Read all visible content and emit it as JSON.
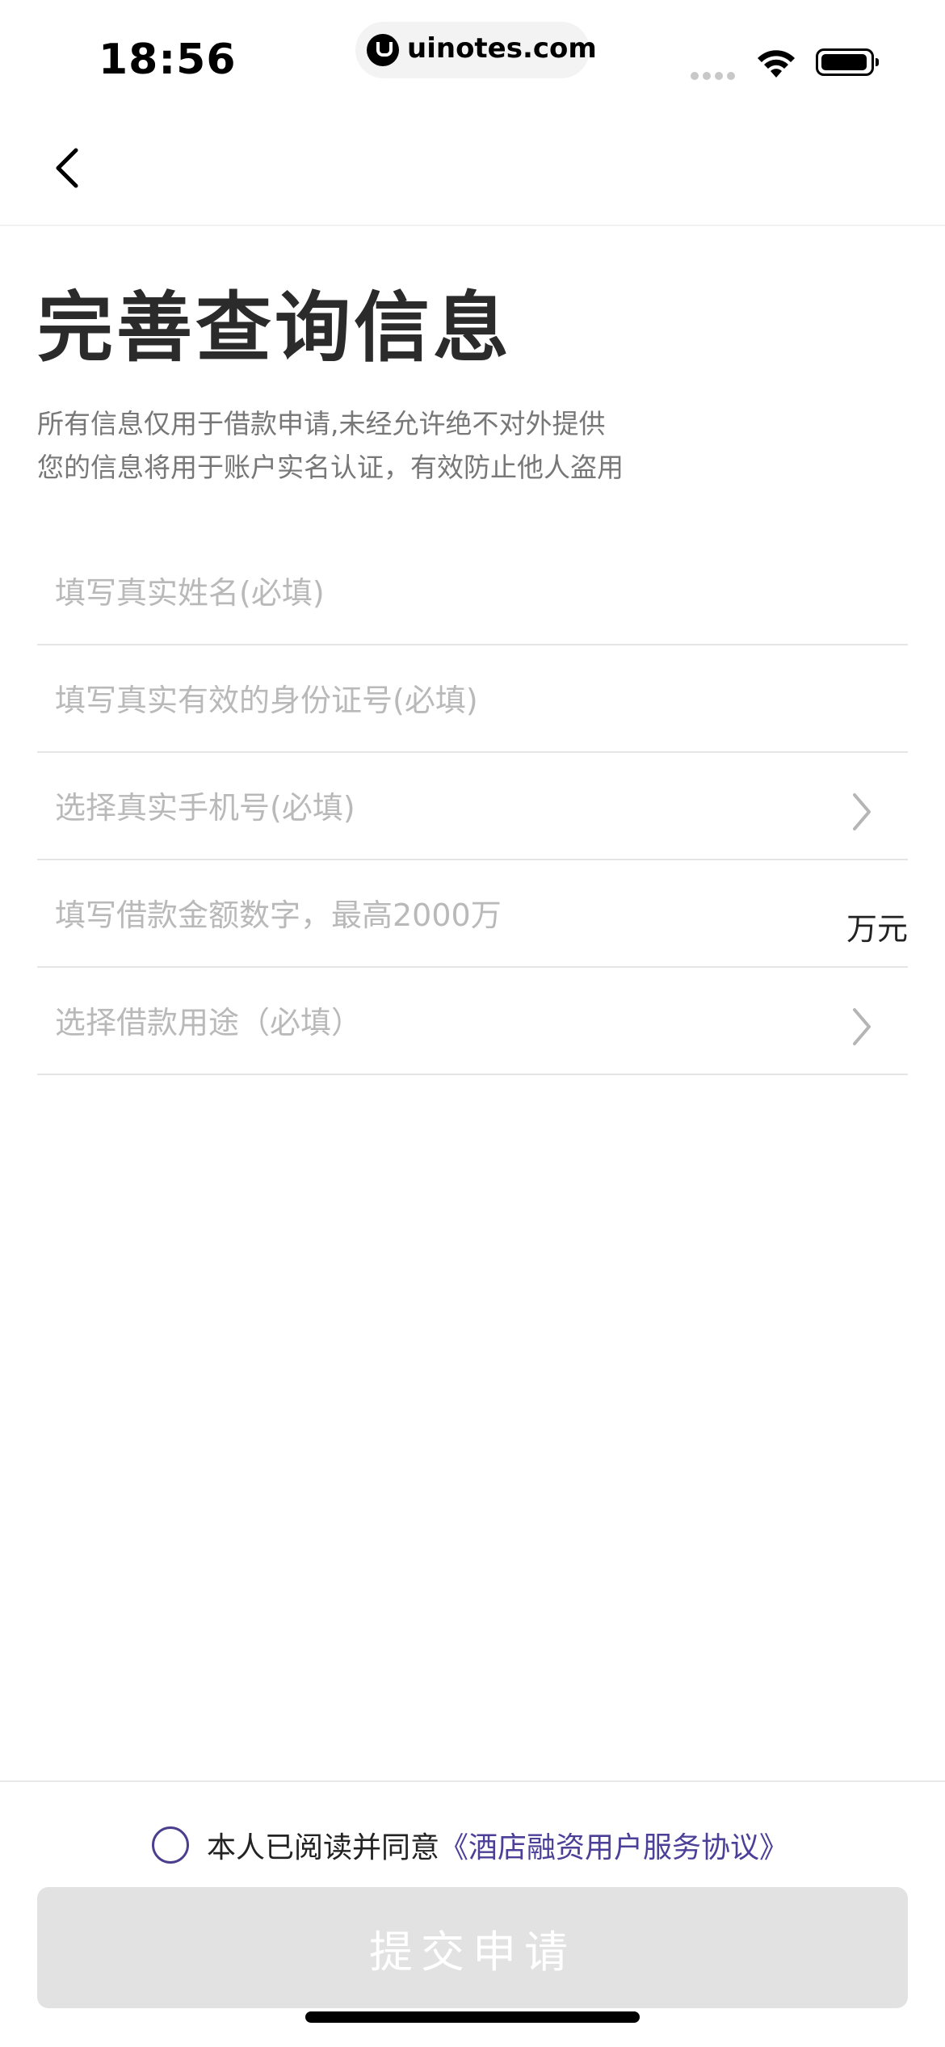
{
  "status_bar": {
    "time": "18:56",
    "url": "uinotes.com"
  },
  "nav": {
    "back_icon": "chevron-left-icon"
  },
  "header": {
    "title": "完善查询信息",
    "subtitle_line1": "所有信息仅用于借款申请,未经允许绝不对外提供",
    "subtitle_line2": "您的信息将用于账户实名认证，有效防止他人盗用"
  },
  "form": {
    "name_placeholder": "填写真实姓名(必填)",
    "id_placeholder": "填写真实有效的身份证号(必填)",
    "phone_placeholder": "选择真实手机号(必填)",
    "amount_placeholder": "填写借款金额数字，最高2000万",
    "amount_unit": "万元",
    "purpose_placeholder": "选择借款用途（必填）"
  },
  "footer": {
    "agree_text": "本人已阅读并同意",
    "agreement_link": "《酒店融资用户服务协议》",
    "submit_label": "提交申请"
  },
  "colors": {
    "link": "#4b3f98",
    "button_disabled": "#e2e2e2"
  }
}
